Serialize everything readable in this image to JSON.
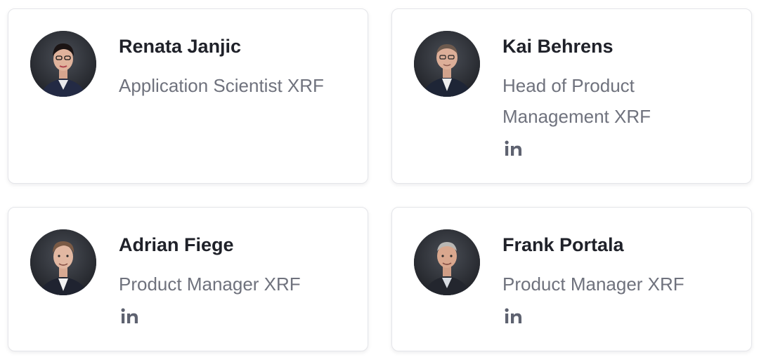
{
  "team": {
    "members": [
      {
        "name": "Renata Janjic",
        "role": "Application Scientist XRF",
        "linkedin_icon": "linkedin-icon",
        "has_linkedin": false
      },
      {
        "name": "Kai Behrens",
        "role": "Head of Product Management XRF",
        "linkedin_icon": "linkedin-icon",
        "has_linkedin": true
      },
      {
        "name": "Adrian Fiege",
        "role": "Product Manager XRF",
        "linkedin_icon": "linkedin-icon",
        "has_linkedin": true
      },
      {
        "name": "Frank Portala",
        "role": "Product Manager XRF",
        "linkedin_icon": "linkedin-icon",
        "has_linkedin": true
      }
    ]
  },
  "colors": {
    "name_text": "#1f2129",
    "role_text": "#6f727d",
    "icon": "#5e6270",
    "card_border": "#e4e5e9",
    "avatar_background": "#2a2d33"
  }
}
